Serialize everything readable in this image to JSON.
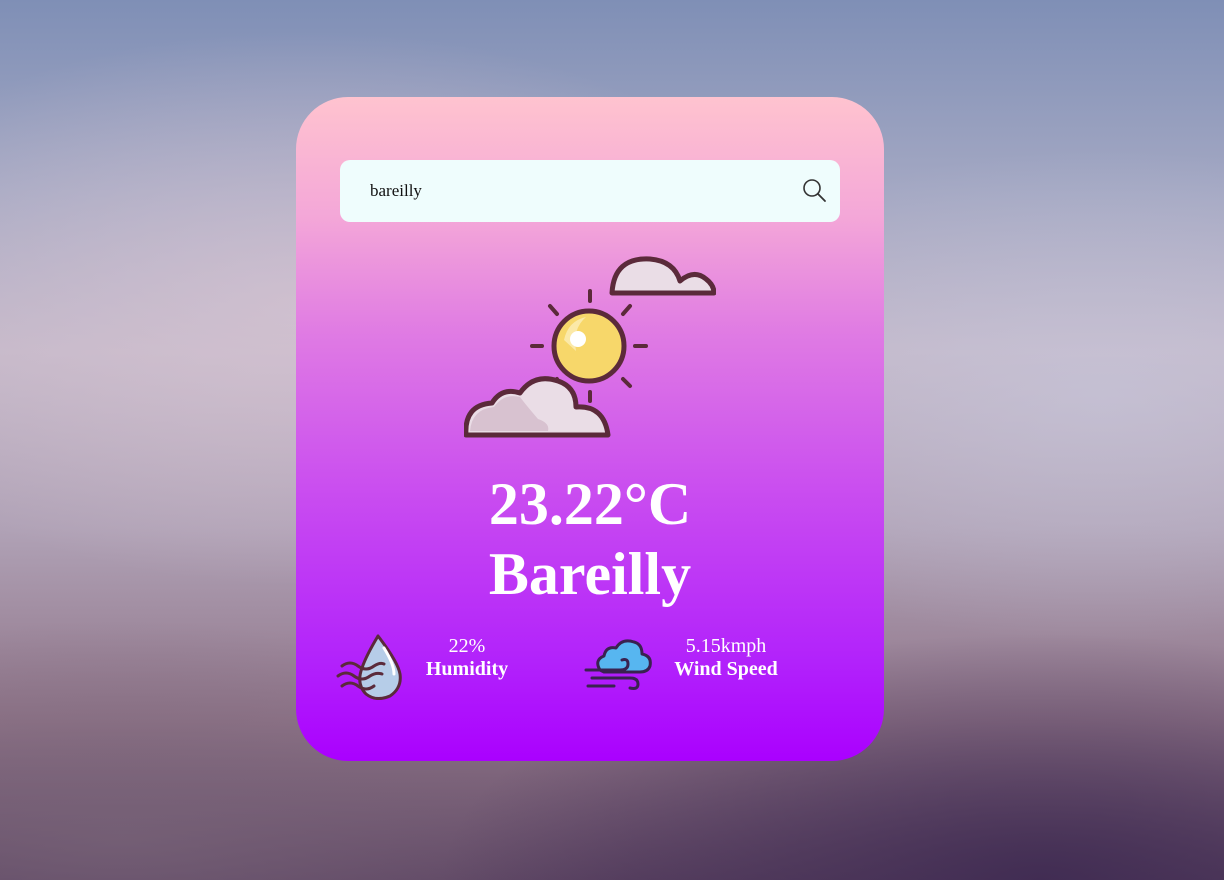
{
  "search": {
    "value": "bareilly",
    "placeholder": "",
    "button_icon": "search-icon"
  },
  "weather": {
    "condition_icon": "sun-with-clouds-icon",
    "temperature": "23.22°C",
    "city": "Bareilly"
  },
  "details": {
    "humidity": {
      "icon": "humidity-icon",
      "value": "22%",
      "label": "Humidity"
    },
    "wind": {
      "icon": "wind-icon",
      "value": "5.15kmph",
      "label": "Wind Speed"
    }
  },
  "colors": {
    "card_top": "#ffc3cf",
    "card_bottom": "#aa00ff",
    "search_bg": "#effdfd",
    "text": "#ffffff"
  }
}
